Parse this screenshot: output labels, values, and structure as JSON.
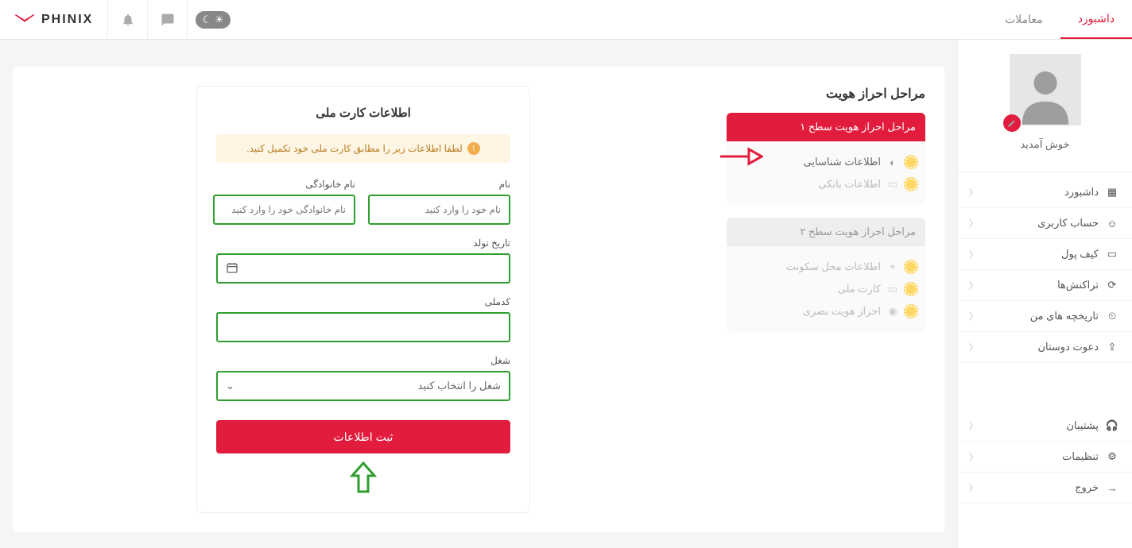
{
  "topbar": {
    "nav_dashboard": "داشبورد",
    "nav_trades": "معاملات",
    "logo_text": "PHINIX"
  },
  "sidebar": {
    "welcome": "خوش آمدید",
    "items": [
      {
        "label": "داشبورد",
        "icon": "grid"
      },
      {
        "label": "حساب کاربری",
        "icon": "user"
      },
      {
        "label": "کیف پول",
        "icon": "wallet"
      },
      {
        "label": "تراکنش‌ها",
        "icon": "refresh"
      },
      {
        "label": "تاریخچه های من",
        "icon": "clock"
      },
      {
        "label": "دعوت دوستان",
        "icon": "share"
      }
    ],
    "bottom": [
      {
        "label": "پشتیبان",
        "icon": "support"
      },
      {
        "label": "تنظیمات",
        "icon": "gear"
      },
      {
        "label": "خروج",
        "icon": "logout"
      }
    ]
  },
  "stages": {
    "title": "مراحل احراز هویت",
    "level1_header": "مراحل احراز هویت سطح ۱",
    "level1_items": [
      {
        "label": "اطلاعات شناسایی",
        "active": true
      },
      {
        "label": "اطلاعات بانکی",
        "active": false
      }
    ],
    "level2_header": "مراحل احراز هویت سطح ۲",
    "level2_items": [
      {
        "label": "اطلاعات محل سکونت"
      },
      {
        "label": "کارت ملی"
      },
      {
        "label": "احراز هویت بصری"
      }
    ]
  },
  "form": {
    "title": "اطلاعات کارت ملی",
    "info": "لطفا اطلاعات زیر را مطابق کارت ملی خود تکمیل کنید.",
    "first_name_label": "نام",
    "first_name_placeholder": "نام خود را وارد کنید",
    "last_name_label": "نام خانوادگی",
    "last_name_placeholder": "نام خانوادگی خود را وارد کنید",
    "birth_date_label": "تاریخ تولد",
    "national_id_label": "کدملی",
    "job_label": "شغل",
    "job_placeholder": "شغل را انتخاب کنید",
    "submit": "ثبت اطلاعات"
  }
}
